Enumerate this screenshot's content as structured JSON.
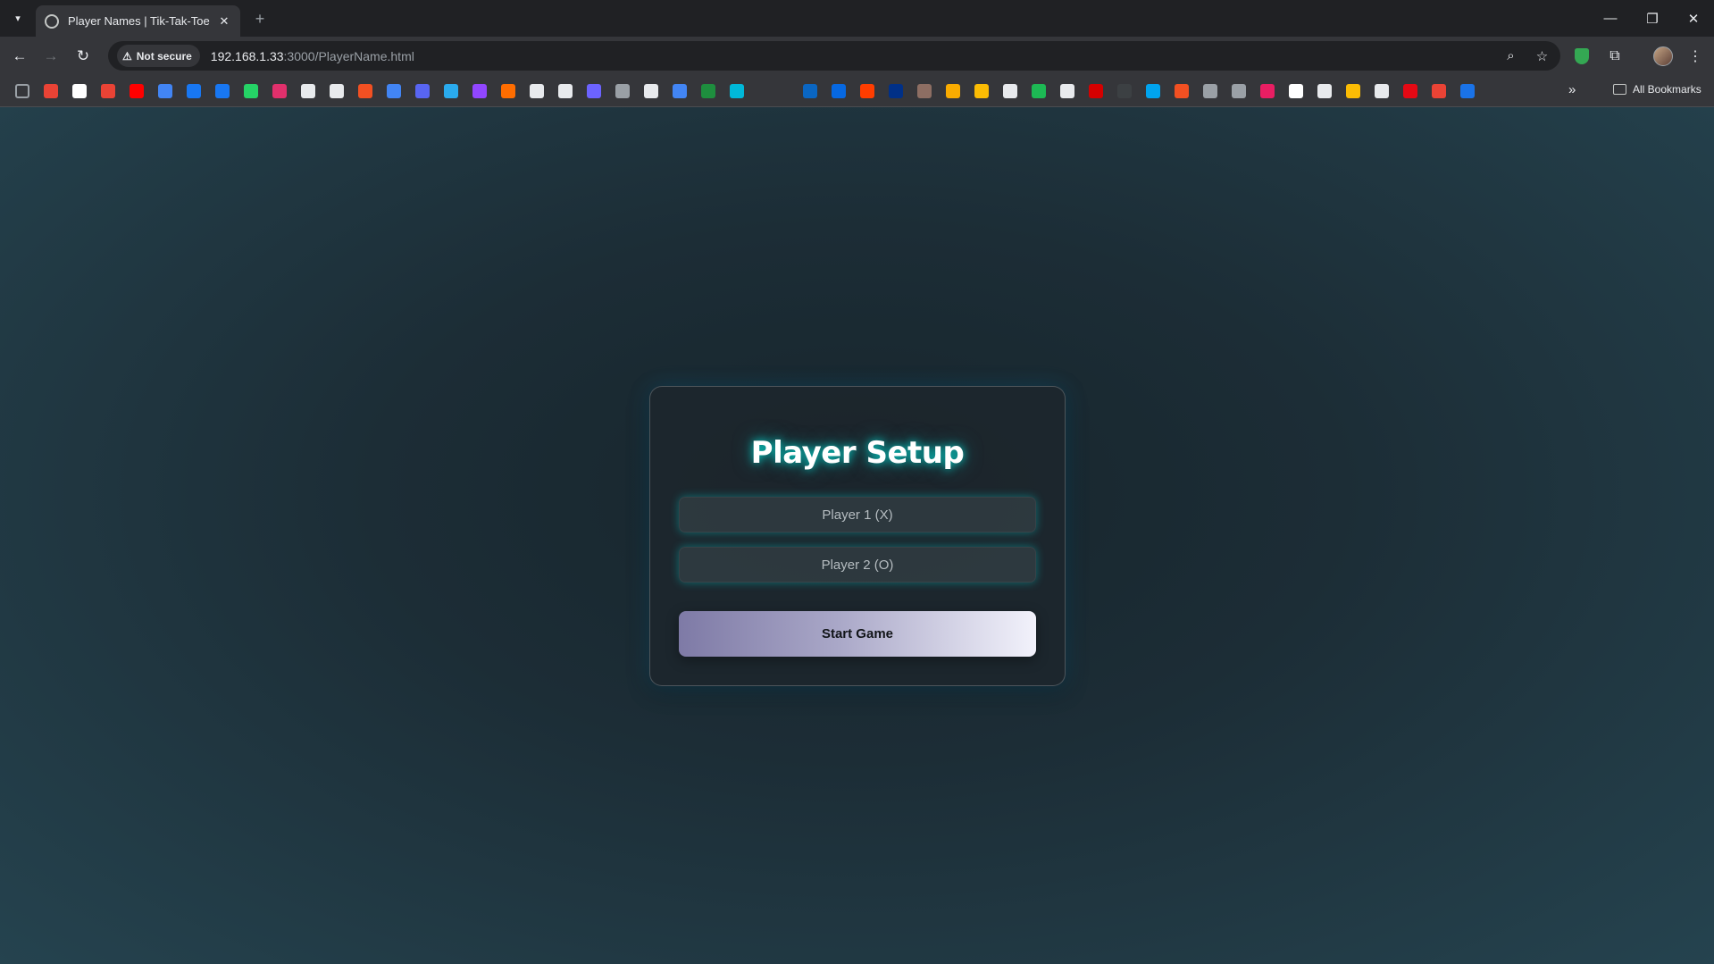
{
  "browser": {
    "tab": {
      "title": "Player Names | Tik-Tak-Toe",
      "close_glyph": "✕"
    },
    "new_tab_glyph": "+",
    "window_controls": {
      "minimize": "—",
      "restore": "❐",
      "close": "✕"
    },
    "security_label": "Not secure",
    "url_host": "192.168.1.33",
    "url_rest": ":3000/PlayerName.html",
    "bookmarks_more": "»",
    "all_bookmarks_label": "All Bookmarks",
    "bookmark_colors": [
      "#9aa0a6",
      "#ea4335",
      "#ffffff",
      "#ea4335",
      "#ff0000",
      "#4285f4",
      "#1877f2",
      "#1877f2",
      "#25d366",
      "#e1306c",
      "#e8eaed",
      "#e8eaed",
      "#f25022",
      "#4285f4",
      "#5865f2",
      "#2aabee",
      "#9146ff",
      "#ff6d00",
      "#e8eaed",
      "#e8eaed",
      "#6c63ff",
      "#9aa0a6",
      "#e8eaed",
      "#4285f4",
      "#1e8e3e",
      "#00b8d9",
      "#0a66c2",
      "#0668e1",
      "#ff3d00",
      "#003087",
      "#8d6e63",
      "#f9ab00",
      "#fbbc04",
      "#e8eaed",
      "#1db954",
      "#e8eaed",
      "#d50000",
      "#3c4043",
      "#00a4ef",
      "#f25022",
      "#9aa0a6",
      "#9aa0a6",
      "#e91e63",
      "#ffffff",
      "#e8eaed",
      "#fbbc04",
      "#e8eaed",
      "#e50914",
      "#ea4335",
      "#1a73e8"
    ]
  },
  "page": {
    "title": "Player Setup",
    "player1_placeholder": "Player 1 (X)",
    "player2_placeholder": "Player 2 (O)",
    "start_label": "Start Game"
  }
}
